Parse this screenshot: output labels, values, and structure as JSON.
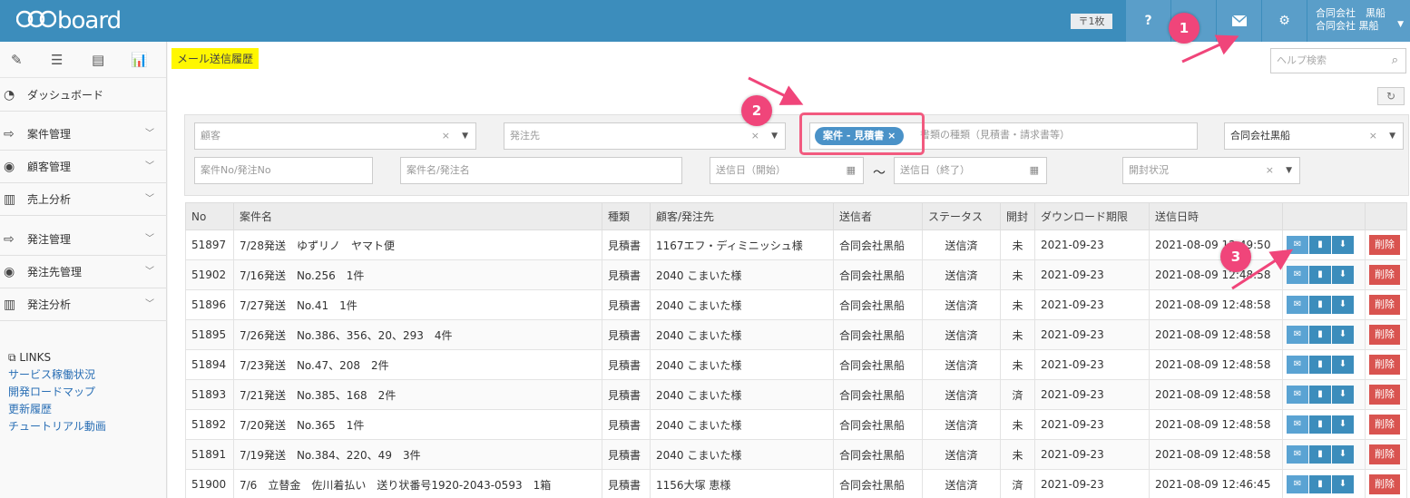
{
  "app": {
    "logo": "board",
    "ticket_label": "〒1枚",
    "help_button": "?",
    "user_name_line1": "合同会社　黒船",
    "user_name_line2": "合同会社 黒船"
  },
  "sidebar": {
    "dashboard": "ダッシュボード",
    "groups": [
      {
        "label": "案件管理"
      },
      {
        "label": "顧客管理"
      },
      {
        "label": "売上分析"
      },
      {
        "label": "発注管理"
      },
      {
        "label": "発注先管理"
      },
      {
        "label": "発注分析"
      }
    ],
    "links_title": "LINKS",
    "links": [
      "サービス稼働状況",
      "開発ロードマップ",
      "更新履歴",
      "チュートリアル動画"
    ]
  },
  "page": {
    "title": "メール送信履歴",
    "help_search_placeholder": "ヘルプ検索"
  },
  "filters": {
    "customer_placeholder": "顧客",
    "supplier_placeholder": "発注先",
    "doc_type_chip": "案件 - 見積書",
    "doc_type_placeholder": "書類の種類（見積書・請求書等）",
    "company_value": "合同会社黒船",
    "project_no_placeholder": "案件No/発注No",
    "project_name_placeholder": "案件名/発注名",
    "sent_from_placeholder": "送信日（開始）",
    "tilde": "～",
    "sent_to_placeholder": "送信日（終了）",
    "open_status_placeholder": "開封状況"
  },
  "table": {
    "headers": [
      "No",
      "案件名",
      "種類",
      "顧客/発注先",
      "送信者",
      "ステータス",
      "開封",
      "ダウンロード期限",
      "送信日時",
      "",
      ""
    ],
    "delete_label": "削除",
    "rows": [
      {
        "no": "51897",
        "name": "7/28発送　ゆずリノ　ヤマト便",
        "type": "見積書",
        "customer": "1167エフ・ディミニッシュ様",
        "sender": "合同会社黒船",
        "status": "送信済",
        "opened": "未",
        "deadline": "2021-09-23",
        "sent_at": "2021-08-09 12:49:50"
      },
      {
        "no": "51902",
        "name": "7/16発送　No.256　1件",
        "type": "見積書",
        "customer": "2040 こまいた様",
        "sender": "合同会社黒船",
        "status": "送信済",
        "opened": "未",
        "deadline": "2021-09-23",
        "sent_at": "2021-08-09 12:48:58"
      },
      {
        "no": "51896",
        "name": "7/27発送　No.41　1件",
        "type": "見積書",
        "customer": "2040 こまいた様",
        "sender": "合同会社黒船",
        "status": "送信済",
        "opened": "未",
        "deadline": "2021-09-23",
        "sent_at": "2021-08-09 12:48:58"
      },
      {
        "no": "51895",
        "name": "7/26発送　No.386、356、20、293　4件",
        "type": "見積書",
        "customer": "2040 こまいた様",
        "sender": "合同会社黒船",
        "status": "送信済",
        "opened": "未",
        "deadline": "2021-09-23",
        "sent_at": "2021-08-09 12:48:58"
      },
      {
        "no": "51894",
        "name": "7/23発送　No.47、208　2件",
        "type": "見積書",
        "customer": "2040 こまいた様",
        "sender": "合同会社黒船",
        "status": "送信済",
        "opened": "未",
        "deadline": "2021-09-23",
        "sent_at": "2021-08-09 12:48:58"
      },
      {
        "no": "51893",
        "name": "7/21発送　No.385、168　2件",
        "type": "見積書",
        "customer": "2040 こまいた様",
        "sender": "合同会社黒船",
        "status": "送信済",
        "opened": "済",
        "deadline": "2021-09-23",
        "sent_at": "2021-08-09 12:48:58"
      },
      {
        "no": "51892",
        "name": "7/20発送　No.365　1件",
        "type": "見積書",
        "customer": "2040 こまいた様",
        "sender": "合同会社黒船",
        "status": "送信済",
        "opened": "未",
        "deadline": "2021-09-23",
        "sent_at": "2021-08-09 12:48:58"
      },
      {
        "no": "51891",
        "name": "7/19発送　No.384、220、49　3件",
        "type": "見積書",
        "customer": "2040 こまいた様",
        "sender": "合同会社黒船",
        "status": "送信済",
        "opened": "未",
        "deadline": "2021-09-23",
        "sent_at": "2021-08-09 12:48:58"
      },
      {
        "no": "51900",
        "name": "7/6　立替金　佐川着払い　送り状番号1920-2043-0593　1箱",
        "type": "見積書",
        "customer": "1156大塚 恵様",
        "sender": "合同会社黒船",
        "status": "送信済",
        "opened": "済",
        "deadline": "2021-09-23",
        "sent_at": "2021-08-09 12:46:45"
      }
    ]
  },
  "annotations": {
    "marker1": "1",
    "marker2": "2",
    "marker3": "3",
    "color": "#f0457a"
  }
}
